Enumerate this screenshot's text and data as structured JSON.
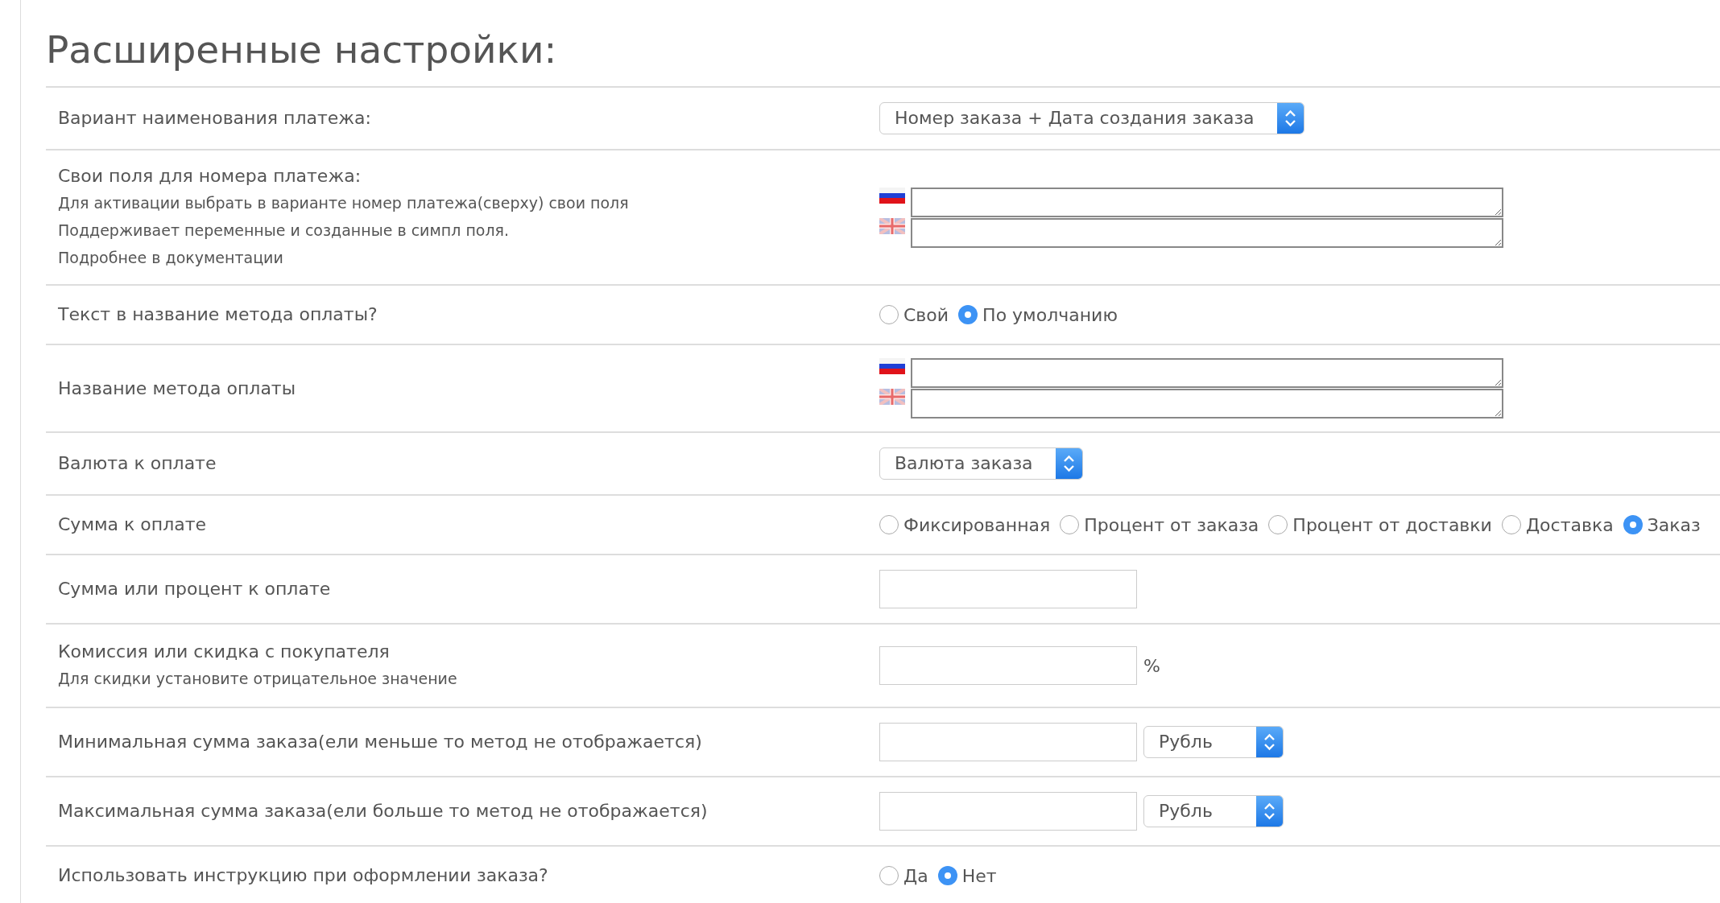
{
  "title": "Расширенные настройки:",
  "rows": [
    {
      "kind": "select",
      "label": "Вариант наименования платежа:",
      "value": "Номер заказа + Дата создания заказа"
    },
    {
      "kind": "flags",
      "label": "Свои поля для номера платежа:",
      "notes": [
        "Для активации выбрать в варианте номер платежа(сверху) свои поля",
        "Поддерживает переменные и созданные в симпл поля.",
        "Подробнее в документации"
      ]
    },
    {
      "kind": "radios",
      "label": "Текст в название метода оплаты?",
      "options": [
        {
          "label": "Свой",
          "selected": false
        },
        {
          "label": "По умолчанию",
          "selected": true
        }
      ]
    },
    {
      "kind": "flags",
      "label": "Название метода оплаты"
    },
    {
      "kind": "select",
      "label": "Валюта к оплате",
      "value": "Валюта заказа"
    },
    {
      "kind": "radios",
      "label": "Сумма к оплате",
      "options": [
        {
          "label": "Фиксированная",
          "selected": false
        },
        {
          "label": "Процент от заказа",
          "selected": false
        },
        {
          "label": "Процент от доставки",
          "selected": false
        },
        {
          "label": "Доставка",
          "selected": false
        },
        {
          "label": "Заказ",
          "selected": true
        }
      ]
    },
    {
      "kind": "input",
      "label": "Сумма или процент к оплате"
    },
    {
      "kind": "input",
      "label": "Комиссия или скидка с покупателя",
      "notes": [
        "Для скидки установите отрицательное значение"
      ],
      "suffix": "%"
    },
    {
      "kind": "input_select",
      "label": "Минимальная сумма заказа(ели меньше то метод не отображается)",
      "value": "Рубль"
    },
    {
      "kind": "input_select",
      "label": "Максимальная сумма заказа(ели больше то метод не отображается)",
      "value": "Рубль"
    },
    {
      "kind": "radios",
      "label": "Использовать инструкцию при оформлении заказа?",
      "options": [
        {
          "label": "Да",
          "selected": false
        },
        {
          "label": "Нет",
          "selected": true
        }
      ]
    }
  ]
}
